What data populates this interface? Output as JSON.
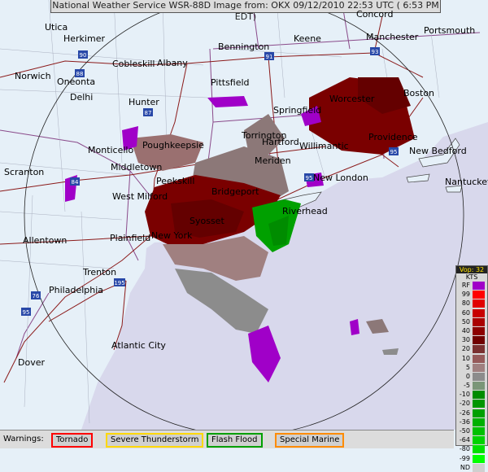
{
  "header": {
    "text": "National Weather Service WSR-88D Image from: OKX 09/12/2010 22:53 UTC ( 6:53 PM EDT)"
  },
  "cities": [
    {
      "name": "Utica"
    },
    {
      "name": "Herkimer"
    },
    {
      "name": "Concord"
    },
    {
      "name": "Portsmouth"
    },
    {
      "name": "Keene"
    },
    {
      "name": "Manchester"
    },
    {
      "name": "Bennington"
    },
    {
      "name": "Cobleskill"
    },
    {
      "name": "Albany"
    },
    {
      "name": "Norwich"
    },
    {
      "name": "Oneonta"
    },
    {
      "name": "Delhi"
    },
    {
      "name": "Pittsfield"
    },
    {
      "name": "Hunter"
    },
    {
      "name": "Worcester"
    },
    {
      "name": "Boston"
    },
    {
      "name": "Springfield"
    },
    {
      "name": "Poughkeepsie"
    },
    {
      "name": "Torrington"
    },
    {
      "name": "Willimantic"
    },
    {
      "name": "Providence"
    },
    {
      "name": "Hartford"
    },
    {
      "name": "Monticello"
    },
    {
      "name": "New Bedford"
    },
    {
      "name": "Middletown"
    },
    {
      "name": "Scranton"
    },
    {
      "name": "Meriden"
    },
    {
      "name": "Peekskill"
    },
    {
      "name": "New London"
    },
    {
      "name": "Nantucket"
    },
    {
      "name": "Bridgeport"
    },
    {
      "name": "West Milford"
    },
    {
      "name": "Riverhead"
    },
    {
      "name": "Syosset"
    },
    {
      "name": "Allentown"
    },
    {
      "name": "Plainfield"
    },
    {
      "name": "New York"
    },
    {
      "name": "Trenton"
    },
    {
      "name": "Philadelphia"
    },
    {
      "name": "Atlantic City"
    },
    {
      "name": "Dover"
    }
  ],
  "highways": [
    "90",
    "88",
    "91",
    "93",
    "87",
    "84",
    "95",
    "95",
    "76",
    "195",
    "95"
  ],
  "legend": {
    "title": "Vop: 32",
    "units": "KTS",
    "levels": [
      {
        "label": "RF",
        "color": "#a000c8"
      },
      {
        "label": "99",
        "color": "#ff0000"
      },
      {
        "label": "80",
        "color": "#e10000"
      },
      {
        "label": "60",
        "color": "#c80000"
      },
      {
        "label": "50",
        "color": "#aa0000"
      },
      {
        "label": "40",
        "color": "#8c0000"
      },
      {
        "label": "30",
        "color": "#700000"
      },
      {
        "label": "20",
        "color": "#7a3030"
      },
      {
        "label": "10",
        "color": "#965a5a"
      },
      {
        "label": "5",
        "color": "#a08080"
      },
      {
        "label": "0",
        "color": "#8c8c8c"
      },
      {
        "label": "-5",
        "color": "#7a9678"
      },
      {
        "label": "-10",
        "color": "#008c00"
      },
      {
        "label": "-20",
        "color": "#009600"
      },
      {
        "label": "-26",
        "color": "#00a000"
      },
      {
        "label": "-36",
        "color": "#00b000"
      },
      {
        "label": "-50",
        "color": "#00c000"
      },
      {
        "label": "-64",
        "color": "#00d200"
      },
      {
        "label": "-80",
        "color": "#00e000"
      },
      {
        "label": "-99",
        "color": "#00ff00"
      },
      {
        "label": "ND",
        "color": "#cfcfcf"
      }
    ]
  },
  "warnings": {
    "label": "Warnings:",
    "items": [
      {
        "label": "Tornado",
        "color": "#ff0000"
      },
      {
        "label": "Severe Thunderstorm",
        "color": "#ffd800"
      },
      {
        "label": "Flash Flood",
        "color": "#00a000"
      },
      {
        "label": "Special Marine",
        "color": "#ff8c00"
      }
    ]
  },
  "colors": {
    "land": "#e6f0f8",
    "ocean": "#d8d8ec",
    "highway": "#8b1a1a",
    "interstate_shield": "#2848a8"
  }
}
